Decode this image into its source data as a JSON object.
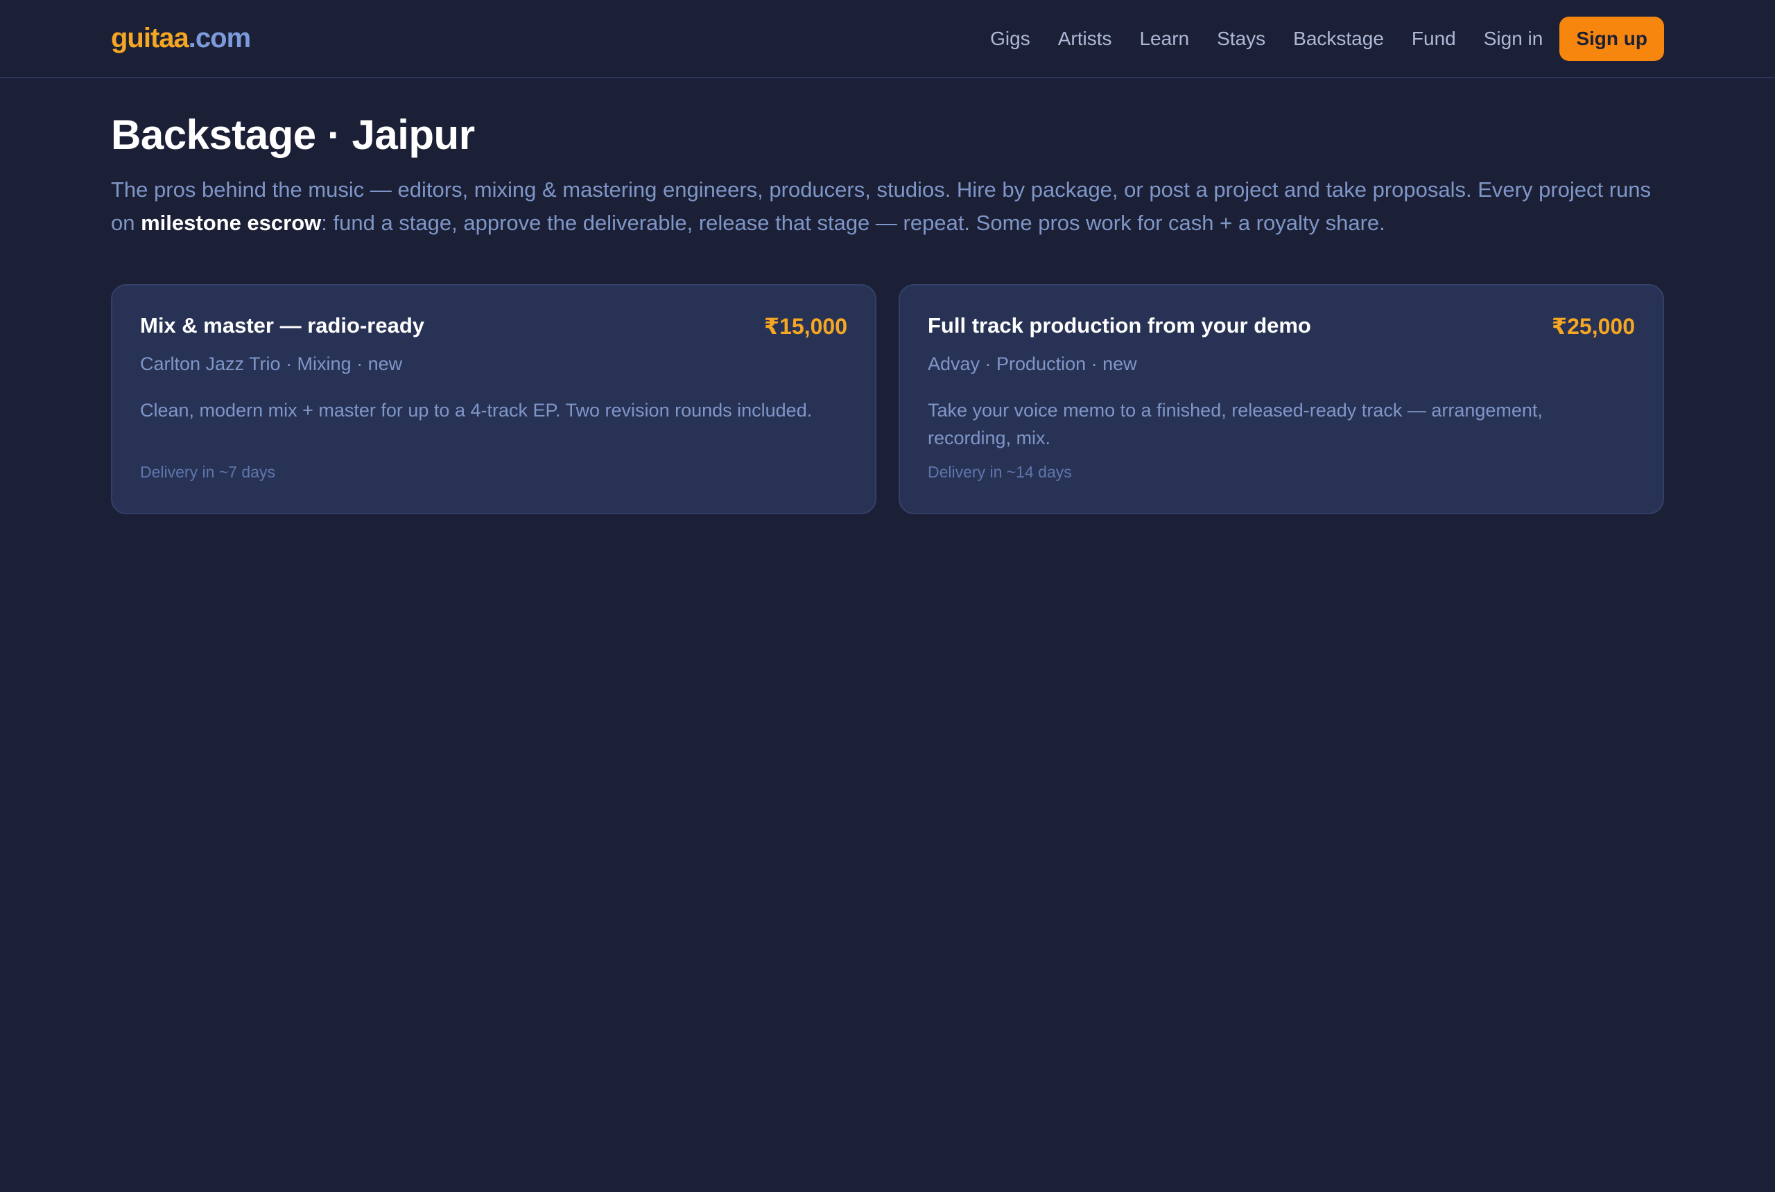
{
  "header": {
    "logo_brand": "guitaa",
    "logo_tld": ".com",
    "nav": [
      "Gigs",
      "Artists",
      "Learn",
      "Stays",
      "Backstage",
      "Fund",
      "Sign in"
    ],
    "signup_label": "Sign up"
  },
  "page": {
    "title": "Backstage · Jaipur",
    "intro_before": "The pros behind the music — editors, mixing & mastering engineers, producers, studios. Hire by package, or post a project and take proposals. Every project runs on ",
    "intro_strong": "milestone escrow",
    "intro_after": ": fund a stage, approve the deliverable, release that stage — repeat. Some pros work for cash + a royalty share."
  },
  "packages": [
    {
      "title": "Mix & master — radio-ready",
      "price": "₹15,000",
      "meta": "Carlton Jazz Trio · Mixing · new",
      "description": "Clean, modern mix + master for up to a 4-track EP. Two revision rounds included.",
      "delivery": "Delivery in ~7 days"
    },
    {
      "title": "Full track production from your demo",
      "price": "₹25,000",
      "meta": "Advay · Production · new",
      "description": "Take your voice memo to a finished, released-ready track — arrangement, recording, mix.",
      "delivery": "Delivery in ~14 days"
    }
  ],
  "colors": {
    "background": "#1b2036",
    "card": "#283254",
    "accent": "#f5a623",
    "signup": "#f7860f",
    "muted_text": "#7f96c8"
  }
}
